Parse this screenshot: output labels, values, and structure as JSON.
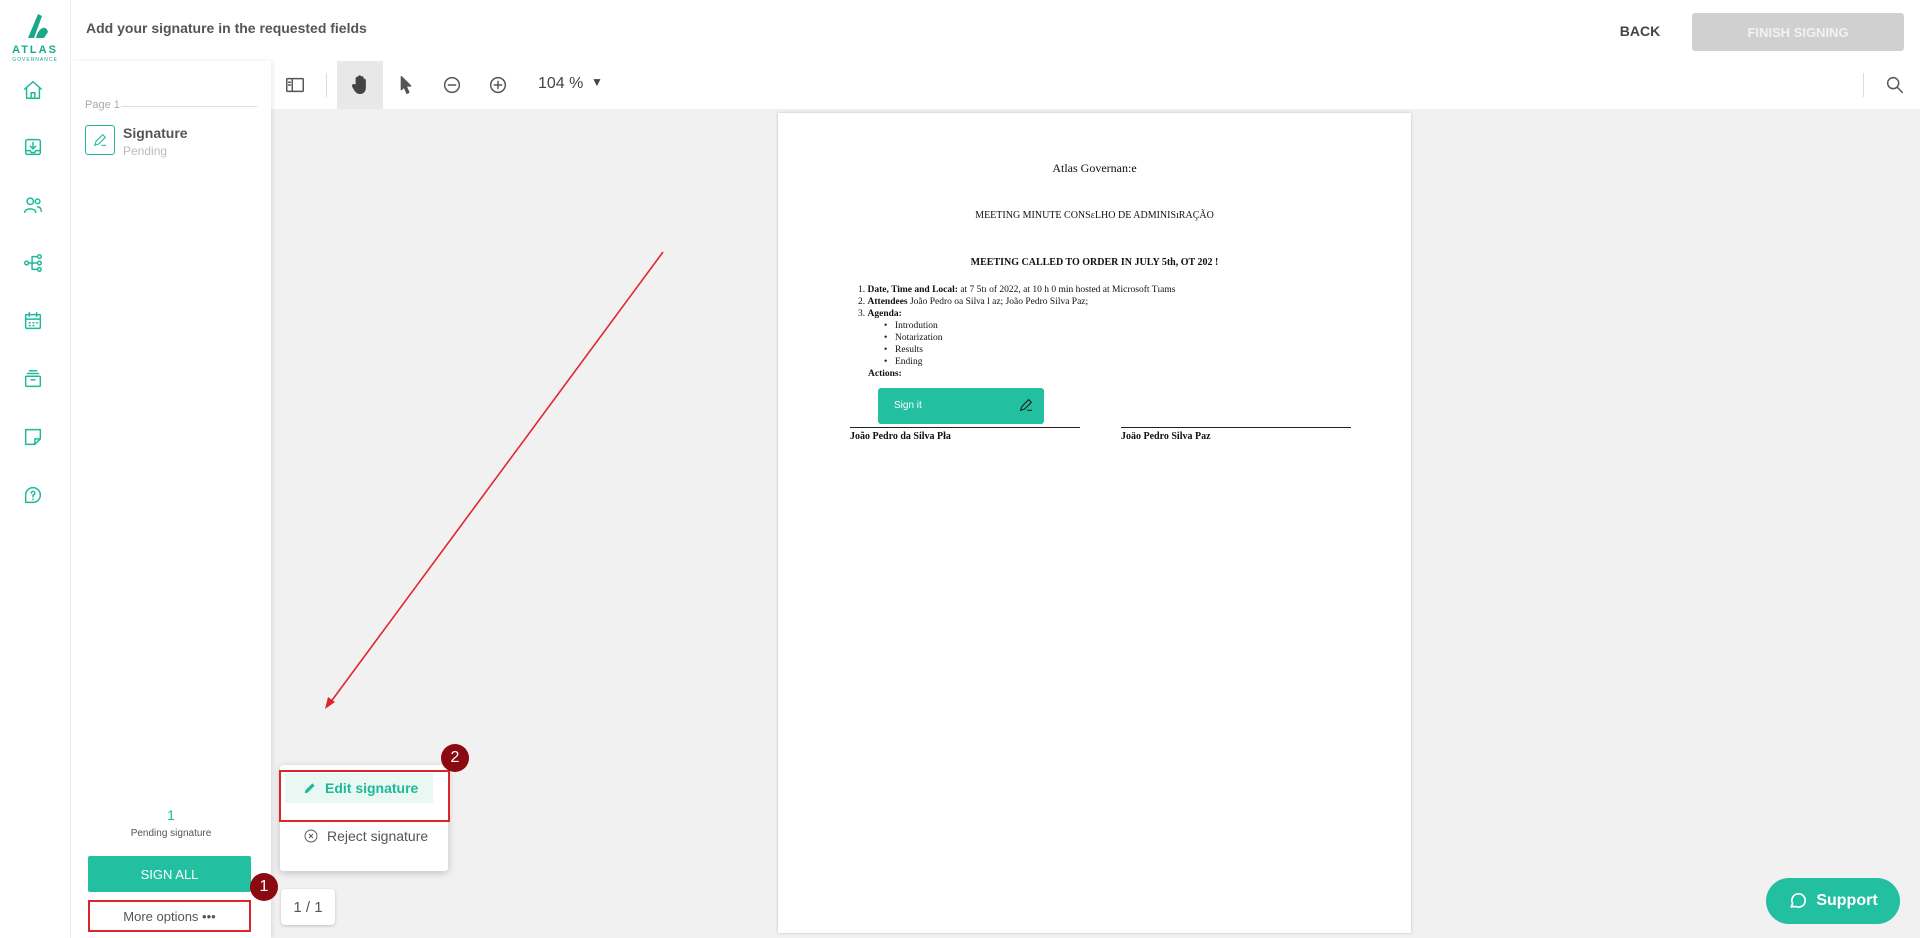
{
  "app": {
    "logo_text": "ATLAS",
    "logo_subtext": "GOVERNANCE"
  },
  "header": {
    "title": "Add your signature in the requested fields",
    "back_label": "BACK",
    "finish_label": "FINISH SIGNING"
  },
  "nav": {
    "items": [
      {
        "name": "home-icon"
      },
      {
        "name": "inbox-download-icon"
      },
      {
        "name": "users-icon"
      },
      {
        "name": "org-chart-icon"
      },
      {
        "name": "calendar-icon"
      },
      {
        "name": "archive-icon"
      },
      {
        "name": "note-icon"
      },
      {
        "name": "help-icon"
      }
    ]
  },
  "left_panel": {
    "page_label": "Page 1",
    "signature_item": {
      "title": "Signature",
      "status": "Pending"
    },
    "pending_count": "1",
    "pending_label": "Pending signature",
    "sign_all_label": "SIGN ALL",
    "more_options_label": "More options •••"
  },
  "toolbar": {
    "zoom_label": "104 %"
  },
  "document": {
    "org": "Atlas Governan:e",
    "title": "MEETING MINUTE CONSɛLHO DE ADMINISıRAÇÃO",
    "call": "MEETING CALLED TO ORDER IN JULY 5th, OT 202 !",
    "items": [
      {
        "num": "1.",
        "bold": "Date, Time and Local:",
        "text": " at 7 5tı of 2022, at 10 h 0 min hosted at Microsoft Tıams"
      },
      {
        "num": "2.",
        "bold": "Attendees",
        "text": "  João Pedro οa Silνa l az; João Pedro Silva Paz;"
      },
      {
        "num": "3.",
        "bold": "Agenda:",
        "text": ""
      }
    ],
    "agenda": [
      "Introdution",
      "Notarization",
      "Results",
      "Ending"
    ],
    "actions_label": "Actions:",
    "sign_it_label": "Sign it",
    "signer_left": "João Pedro da Silva Pła",
    "signer_right": "Joäo Pedro Silva Paz"
  },
  "menu": {
    "edit_label": "Edit signature",
    "reject_label": "Reject signature"
  },
  "page_counter": "1 / 1",
  "steps": {
    "step1": "1",
    "step2": "2"
  },
  "support_label": "Support",
  "colors": {
    "accent": "#22bfa0",
    "annotation_red": "#d9262b",
    "step_marker": "#8b0a12"
  }
}
